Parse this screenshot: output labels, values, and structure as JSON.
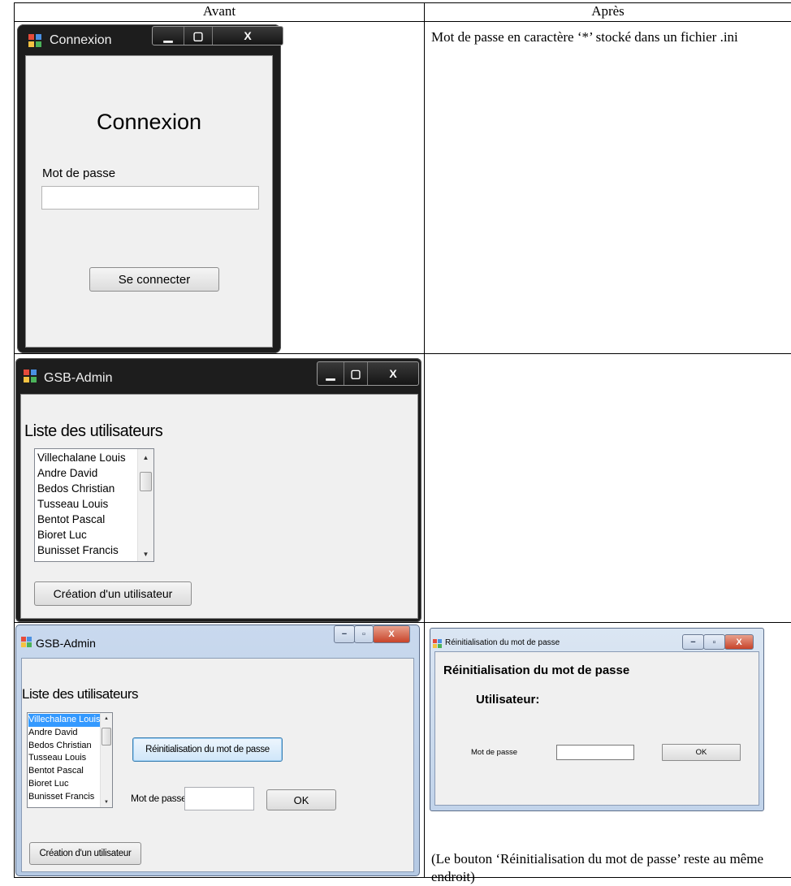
{
  "table": {
    "headers": [
      "Avant",
      "Après"
    ]
  },
  "row1": {
    "note": "Mot de passe en caractère ‘*’ stocké dans un fichier .ini",
    "window": {
      "title": "Connexion",
      "heading": "Connexion",
      "password_label": "Mot de passe",
      "password_value": "",
      "connect_button": "Se connecter"
    }
  },
  "row2": {
    "window": {
      "title": "GSB-Admin",
      "list_title": "Liste des utilisateurs",
      "users": [
        "Villechalane Louis",
        "Andre David",
        "Bedos Christian",
        "Tusseau Louis",
        "Bentot Pascal",
        "Bioret Luc",
        "Bunisset Francis"
      ],
      "create_button": "Création d'un utilisateur"
    }
  },
  "row3": {
    "before": {
      "title": "GSB-Admin",
      "list_title": "Liste des utilisateurs",
      "users": [
        "Villechalane Louis",
        "Andre David",
        "Bedos Christian",
        "Tusseau Louis",
        "Bentot Pascal",
        "Bioret Luc",
        "Bunisset Francis"
      ],
      "selected_index": 0,
      "reset_button": "Réinitialisation du mot de passe",
      "password_label": "Mot de passe",
      "ok_button": "OK",
      "create_button": "Création d'un utilisateur"
    },
    "after": {
      "title": "Réinitialisation du mot de passe",
      "heading": "Réinitialisation du mot de passe",
      "user_label": "Utilisateur:",
      "password_label": "Mot de passe",
      "ok_button": "OK"
    },
    "note": "(Le bouton ‘Réinitialisation du mot de passe’ reste au même endroit)"
  },
  "colors": {
    "selection": "#3399ff",
    "titlebar_dark": "#1d1d1d",
    "close_red": "#c8442a"
  }
}
